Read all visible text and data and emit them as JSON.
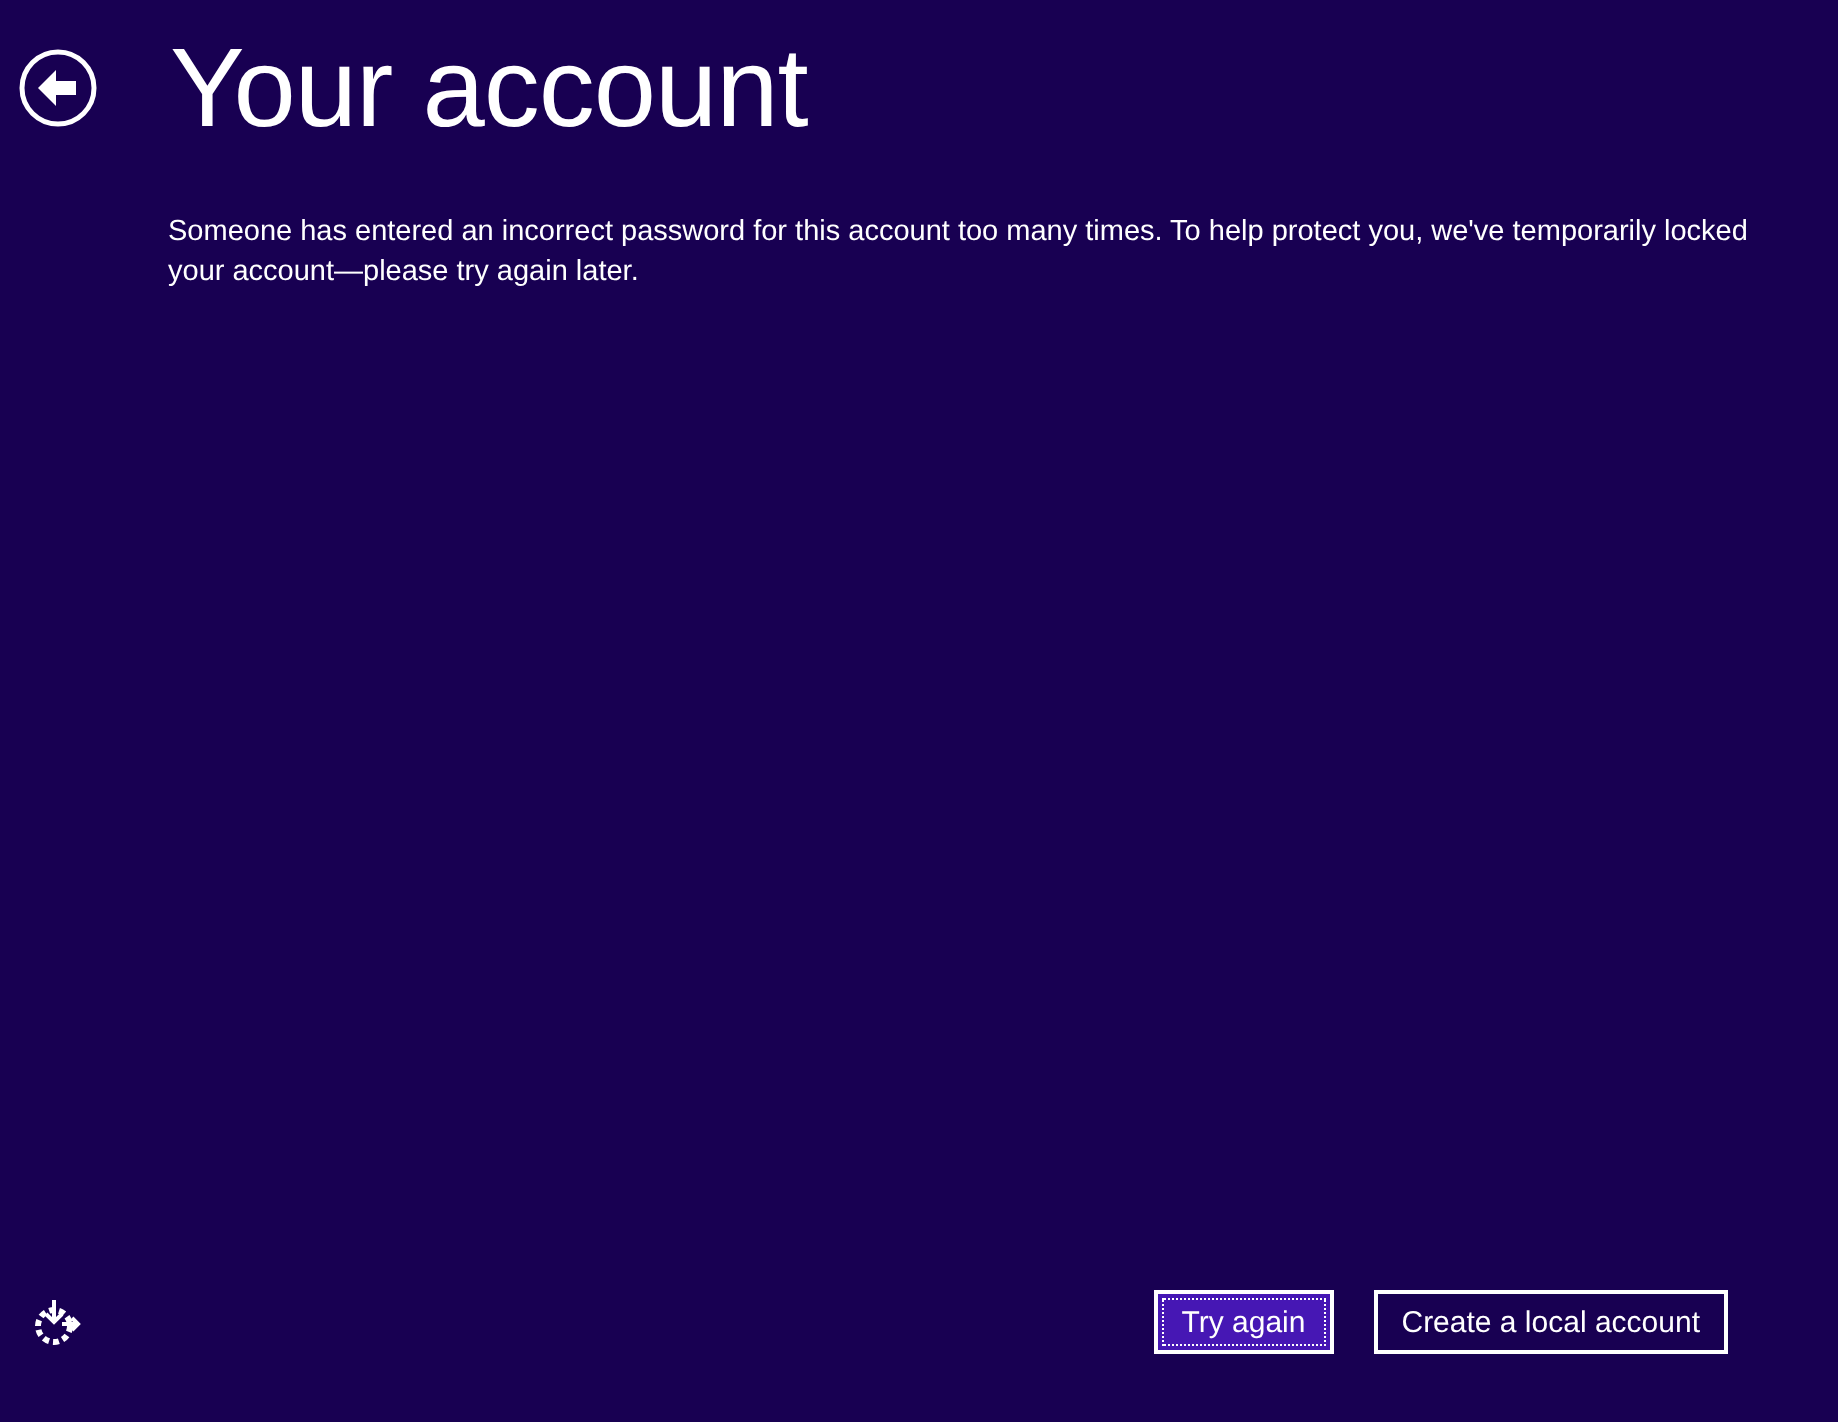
{
  "title": "Your account",
  "message": "Someone has entered an incorrect password for this account too many times. To help protect you, we've temporarily locked your account—please try again later.",
  "buttons": [
    {
      "label": "Try again",
      "focused": true
    },
    {
      "label": "Create a local account",
      "focused": false
    }
  ]
}
